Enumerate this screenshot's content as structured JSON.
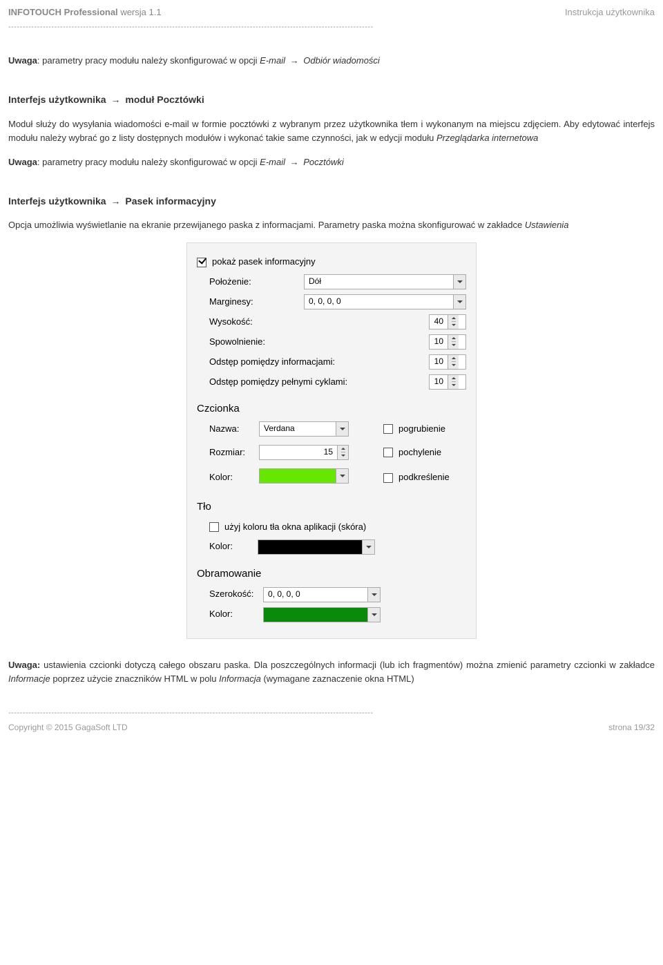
{
  "header": {
    "product_bold": "INFOTOUCH Professional",
    "version": "wersja 1.1",
    "right": "Instrukcja użytkownika"
  },
  "dash_line": "-------------------------------------------------------------------------------------------------------------------------------",
  "p1": {
    "bold": "Uwaga",
    "text": ": parametry pracy modułu należy skonfigurować w opcji ",
    "em1": "E-mail",
    "arrow": "→",
    "em2": "Odbiór wiadomości"
  },
  "h1": {
    "a": "Interfejs użytkownika",
    "arrow": "→",
    "b": "moduł  Pocztówki"
  },
  "p2": "Moduł służy do wysyłania wiadomości e-mail w formie pocztówki z wybranym przez użytkownika tłem i wykonanym na miejscu zdjęciem. Aby edytować interfejs modułu należy wybrać go z listy dostępnych modułów i wykonać takie same czynności, jak w edycji modułu ",
  "p2_em": "Przeglądarka internetowa",
  "p3": {
    "bold": "Uwaga",
    "text": ": parametry pracy modułu należy skonfigurować w opcji ",
    "em1": "E-mail",
    "arrow": "→",
    "em2": "Pocztówki"
  },
  "h2": {
    "a": "Interfejs użytkownika",
    "arrow": "→",
    "b": "Pasek informacyjny"
  },
  "p4a": "Opcja umożliwia wyświetlanie na ekranie przewijanego paska z informacjami. Parametry paska można skonfigurować w zakładce ",
  "p4_em": "Ustawienia",
  "panel": {
    "show_bar_label": "pokaż pasek informacyjny",
    "show_bar_checked": true,
    "position_label": "Położenie:",
    "position_value": "Dół",
    "margins_label": "Marginesy:",
    "margins_value": "0, 0, 0, 0",
    "height_label": "Wysokość:",
    "height_value": "40",
    "slowdown_label": "Spowolnienie:",
    "slowdown_value": "10",
    "gap_info_label": "Odstęp pomiędzy informacjami:",
    "gap_info_value": "10",
    "gap_cycles_label": "Odstęp pomiędzy pełnymi cyklami:",
    "gap_cycles_value": "10",
    "font_section": "Czcionka",
    "font_name_label": "Nazwa:",
    "font_name_value": "Verdana",
    "font_size_label": "Rozmiar:",
    "font_size_value": "15",
    "font_color_label": "Kolor:",
    "font_color_value": "#66e600",
    "bold_label": "pogrubienie",
    "italic_label": "pochylenie",
    "underline_label": "podkreślenie",
    "bg_section": "Tło",
    "bg_use_app_label": "użyj koloru tła okna aplikacji (skóra)",
    "bg_color_label": "Kolor:",
    "bg_color_value": "#000000",
    "border_section": "Obramowanie",
    "border_width_label": "Szerokość:",
    "border_width_value": "0, 0, 0, 0",
    "border_color_label": "Kolor:",
    "border_color_value": "#0a8a0a"
  },
  "p5": {
    "bold": "Uwaga:",
    "t1": " ustawienia czcionki dotyczą całego obszaru paska. Dla poszczególnych informacji (lub ich fragmentów) można zmienić parametry czcionki w zakładce ",
    "em1": "Informacje",
    "t2": " poprzez użycie znaczników HTML w polu ",
    "em2": "Informacja",
    "t3": " (wymagane zaznaczenie okna HTML)"
  },
  "footer": {
    "left": "Copyright © 2015 GagaSoft LTD",
    "right": "strona 19/32"
  }
}
